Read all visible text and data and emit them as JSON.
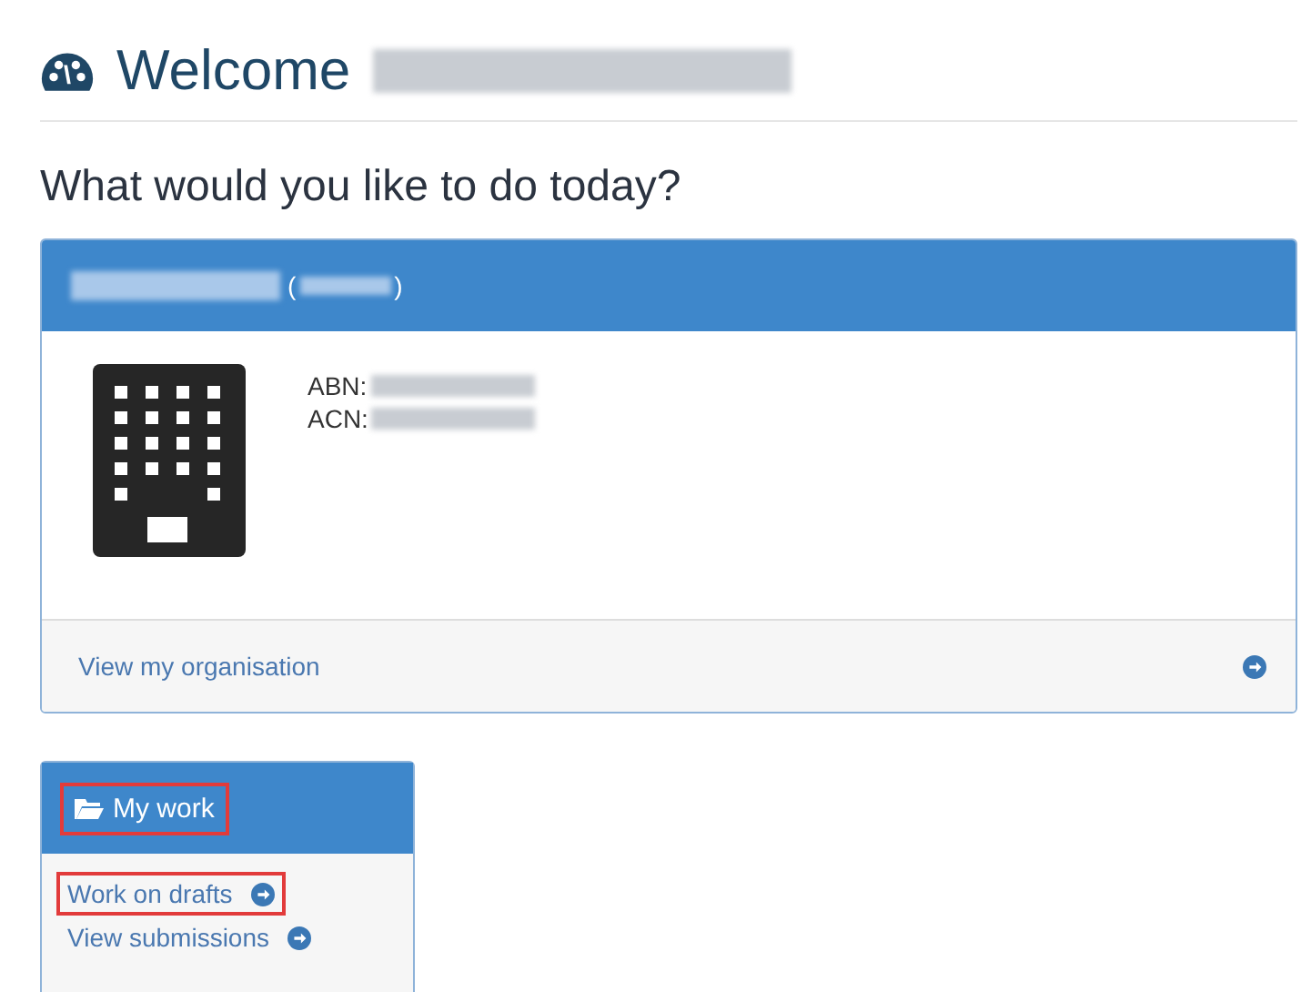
{
  "header": {
    "title": "Welcome",
    "name_redacted": true
  },
  "prompt": "What would you like to do today?",
  "organisation": {
    "name_redacted": true,
    "id_redacted": true,
    "id_open": "(",
    "id_close": ")",
    "fields": [
      {
        "label": "ABN:",
        "redacted": true
      },
      {
        "label": "ACN:",
        "redacted": true
      }
    ],
    "link": "View my organisation"
  },
  "my_work": {
    "title": "My work",
    "highlighted": true,
    "items": [
      {
        "label": "Work on drafts",
        "highlighted": true
      },
      {
        "label": "View submissions",
        "highlighted": false
      }
    ]
  }
}
